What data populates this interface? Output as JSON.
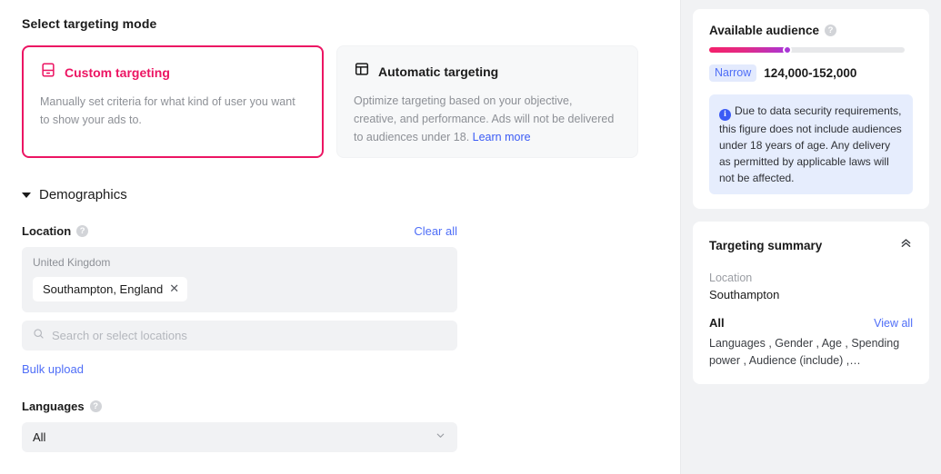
{
  "left": {
    "heading": "Select targeting mode",
    "modes": [
      {
        "icon": "device-icon",
        "title": "Custom targeting",
        "desc": "Manually set criteria for what kind of user you want to show your ads to.",
        "selected": true
      },
      {
        "icon": "layout-panel-icon",
        "title": "Automatic targeting",
        "desc": "Optimize targeting based on your objective, creative, and performance. Ads will not be delivered to audiences under 18. ",
        "link_label": "Learn more",
        "selected": false
      }
    ],
    "demographics": {
      "title": "Demographics",
      "toggle_icon": "caret-down-icon",
      "location": {
        "label": "Location",
        "help_icon": "help-icon",
        "clear_all": "Clear all",
        "country": "United Kingdom",
        "chips": [
          {
            "label": "Southampton, England",
            "remove_icon": "close-icon"
          }
        ],
        "search_placeholder": "Search or select locations",
        "search_icon": "search-icon",
        "bulk_upload": "Bulk upload"
      },
      "languages": {
        "label": "Languages",
        "help_icon": "help-icon",
        "value": "All",
        "chevron_icon": "chevron-down-icon"
      }
    }
  },
  "right": {
    "audience": {
      "title": "Available audience",
      "help_icon": "help-icon",
      "gauge_fill_percent": 40,
      "badge": "Narrow",
      "range": "124,000-152,000",
      "notice_icon": "info-icon",
      "notice": "Due to data security requirements, this figure does not include audiences under 18 years of age. Any delivery as permitted by applicable laws will not be affected."
    },
    "summary": {
      "title": "Targeting summary",
      "collapse_icon": "double-chevron-up-icon",
      "location_label": "Location",
      "location_value": "Southampton",
      "all_label": "All",
      "view_all": "View all",
      "items_text": "Languages , Gender , Age , Spending power , Audience (include) ,…"
    }
  },
  "colors": {
    "accent_pink": "#ec1563",
    "link_blue": "#4f6ef7",
    "panel_gray": "#f1f2f4"
  }
}
